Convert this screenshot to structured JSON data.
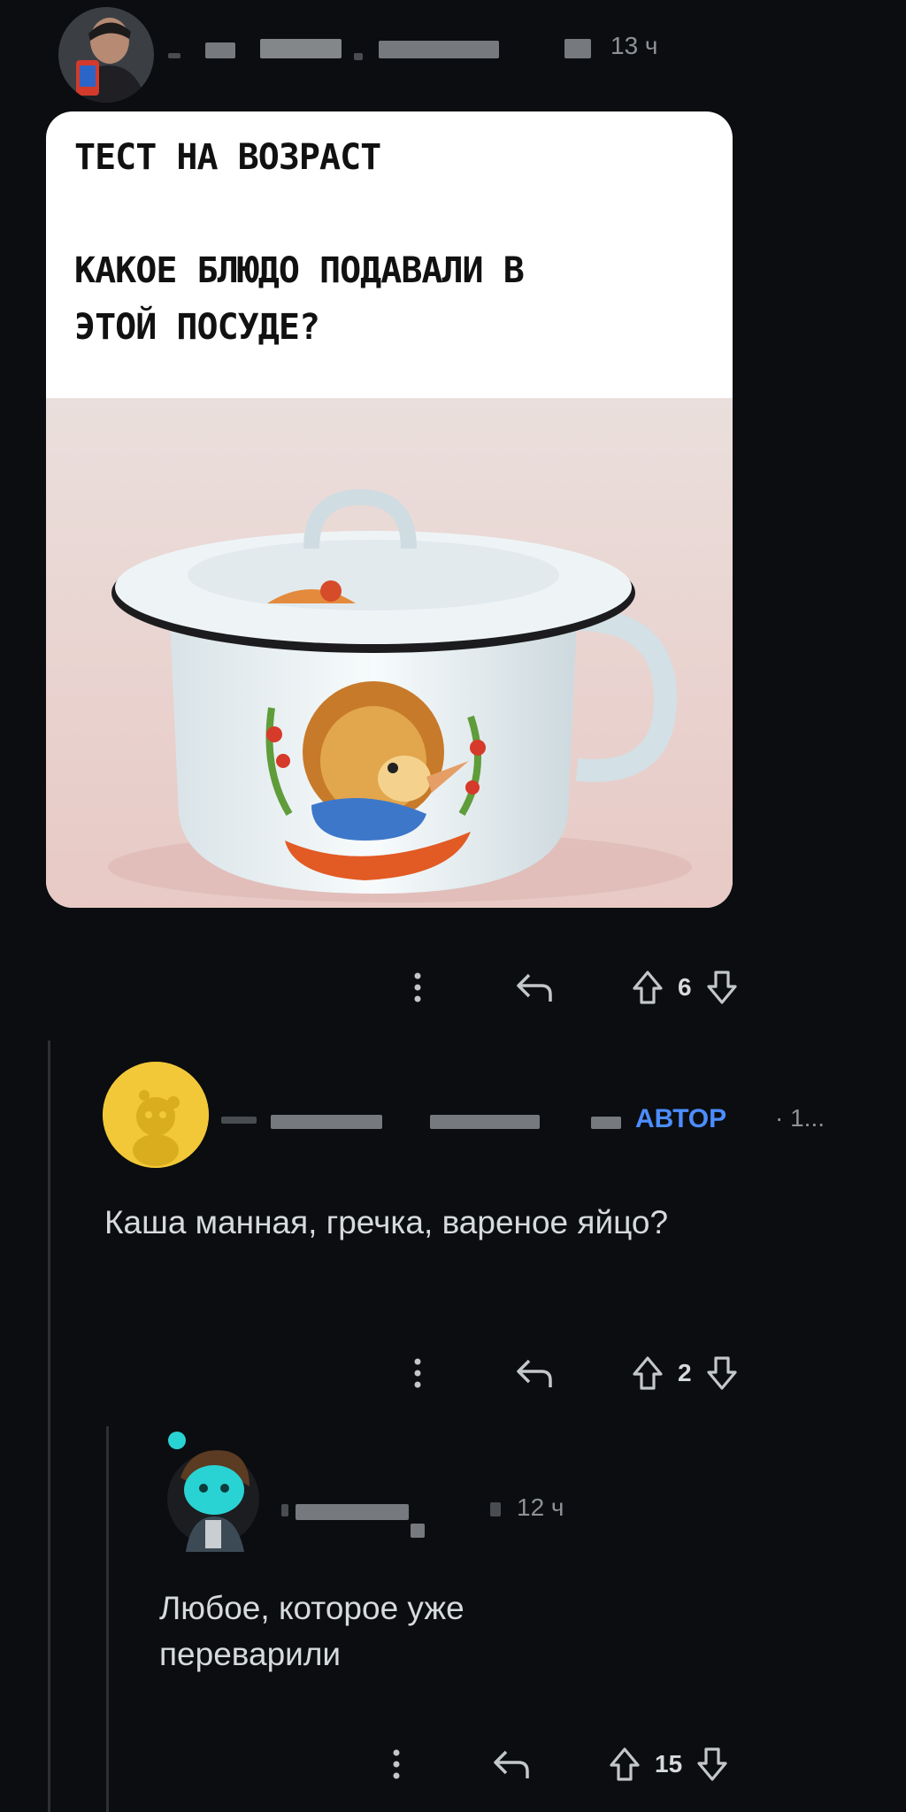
{
  "post": {
    "time": "13 ч",
    "title_lines": "ТЕСТ НА ВОЗРАСТ\n\nКАКОЕ БЛЮДО ПОДАВАЛИ В\nЭТОЙ ПОСУДЕ?",
    "vote_count": "6"
  },
  "comment1": {
    "badge": "АВТОР",
    "time": "· 1...",
    "text": "Каша манная, гречка, вареное яйцо?",
    "vote_count": "2"
  },
  "comment2": {
    "time": "12 ч",
    "text": "Любое, которое уже переварили",
    "vote_count": "15"
  },
  "icons": {
    "more": "more-vertical-icon",
    "reply": "reply-arrow-icon",
    "upvote": "upvote-arrow-icon",
    "downvote": "downvote-arrow-icon"
  },
  "colors": {
    "background": "#0b0d10",
    "author_badge": "#4c8dff",
    "avatar_yellow": "#f2c838",
    "avatar_teal": "#2ad3d3"
  }
}
